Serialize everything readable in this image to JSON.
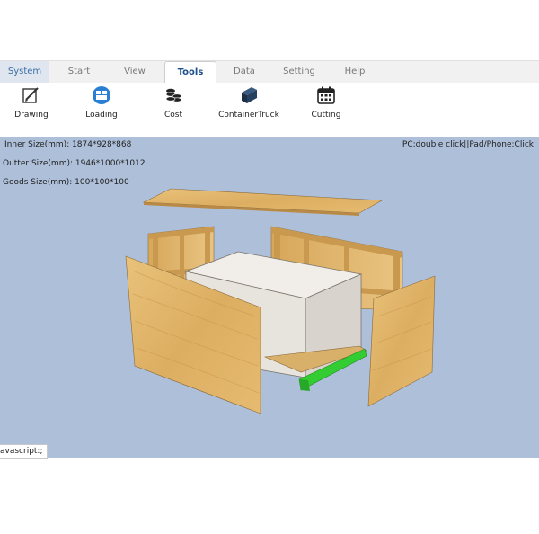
{
  "tabs": [
    {
      "label": "System"
    },
    {
      "label": "Start"
    },
    {
      "label": "View"
    },
    {
      "label": "Tools"
    },
    {
      "label": "Data"
    },
    {
      "label": "Setting"
    },
    {
      "label": "Help"
    }
  ],
  "active_tab": "Tools",
  "tools": [
    {
      "label": "Drawing",
      "icon": "drawing-icon"
    },
    {
      "label": "Loading",
      "icon": "loading-icon"
    },
    {
      "label": "Cost",
      "icon": "coins-icon"
    },
    {
      "label": "ContainerTruck",
      "icon": "container-icon"
    },
    {
      "label": "Cutting",
      "icon": "calendar-icon"
    }
  ],
  "info": {
    "inner_size": "Inner Size(mm): 1874*928*868",
    "outter_size": "Outter Size(mm): 1946*1000*1012",
    "goods_size": "Goods Size(mm): 100*100*100",
    "hint": "PC:double click||Pad/Phone:Click"
  },
  "status_text": "avascript:;",
  "colors": {
    "viewport_bg": "#aebfd9",
    "wood": "#e2b56a",
    "goods": "#e8e4df",
    "pallet_base": "#33cc33",
    "active_tab_text": "#1c4f8a"
  }
}
